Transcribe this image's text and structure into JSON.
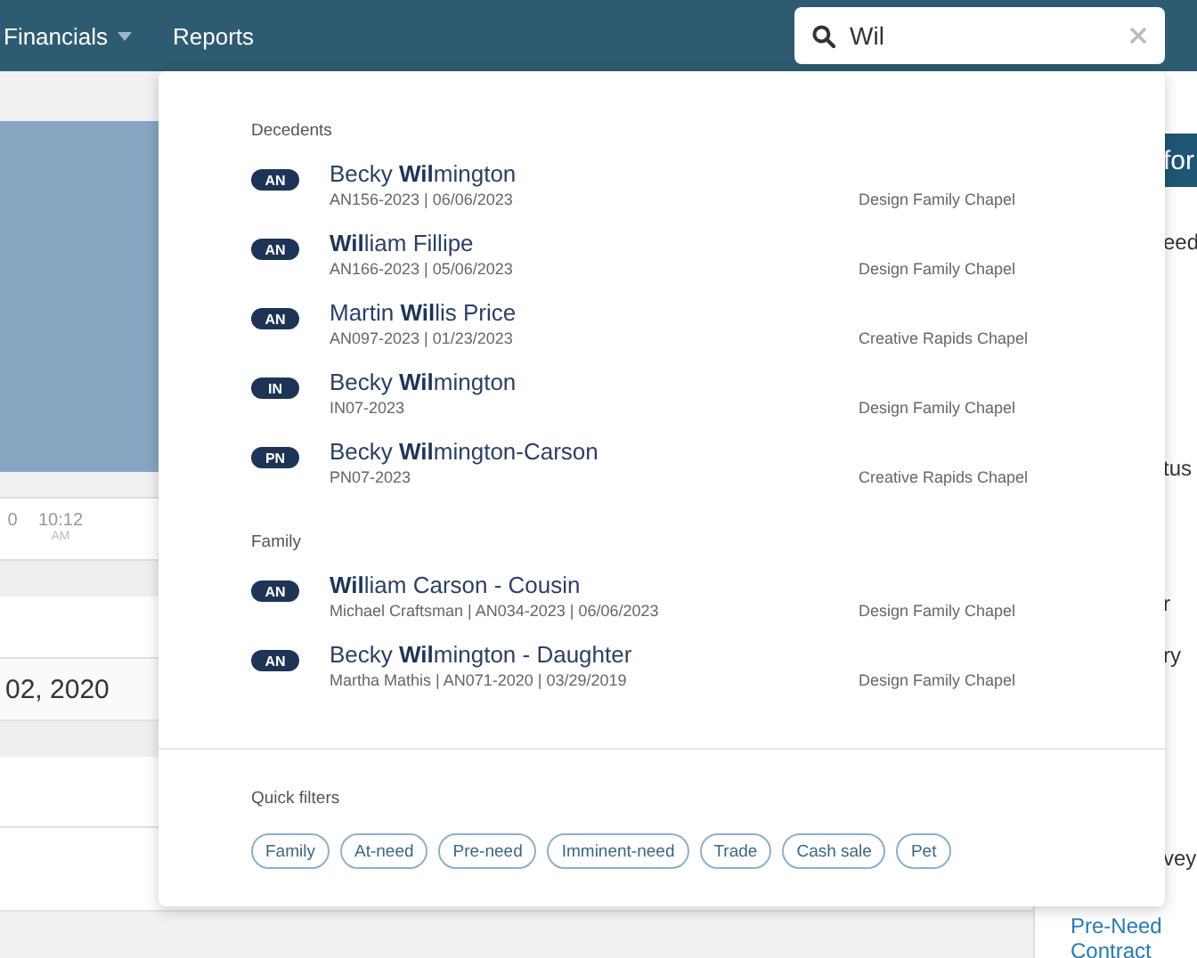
{
  "nav": {
    "items": [
      {
        "label": "Financials",
        "dropdown": true
      },
      {
        "label": "Reports",
        "dropdown": false
      }
    ]
  },
  "search": {
    "value": "Wil"
  },
  "background": {
    "axis_labels": [
      {
        "time": "0"
      },
      {
        "time": "10:12",
        "period": "AM"
      }
    ],
    "date_fragment": "02, 2020",
    "panel_header": "for",
    "panel_fragments": [
      "eed",
      "tus",
      "r",
      "ry",
      "vey"
    ],
    "panel_link": "Pre-Need Contract"
  },
  "results": {
    "sections": [
      {
        "title": "Decedents",
        "items": [
          {
            "badge": "AN",
            "name": "Becky **Wil**mington",
            "detail": "AN156-2023 | 06/06/2023",
            "location": "Design Family Chapel"
          },
          {
            "badge": "AN",
            "name": "**Wil**liam Fillipe",
            "detail": "AN166-2023 | 05/06/2023",
            "location": "Design Family Chapel"
          },
          {
            "badge": "AN",
            "name": "Martin **Wil**lis Price",
            "detail": "AN097-2023 | 01/23/2023",
            "location": "Creative Rapids Chapel"
          },
          {
            "badge": "IN",
            "name": "Becky **Wil**mington",
            "detail": "IN07-2023",
            "location": "Design Family Chapel"
          },
          {
            "badge": "PN",
            "name": "Becky **Wil**mington-Carson",
            "detail": "PN07-2023",
            "location": "Creative Rapids Chapel"
          }
        ]
      },
      {
        "title": "Family",
        "items": [
          {
            "badge": "AN",
            "name": "**Wil**liam Carson - Cousin",
            "detail": "Michael Craftsman | AN034-2023 | 06/06/2023",
            "location": "Design Family Chapel"
          },
          {
            "badge": "AN",
            "name": "Becky **Wil**mington - Daughter",
            "detail": "Martha Mathis | AN071-2020 | 03/29/2019",
            "location": "Design Family Chapel"
          }
        ]
      }
    ]
  },
  "quick_filters": {
    "title": "Quick filters",
    "chips": [
      "Family",
      "At-need",
      "Pre-need",
      "Imminent-need",
      "Trade",
      "Cash sale",
      "Pet"
    ]
  }
}
